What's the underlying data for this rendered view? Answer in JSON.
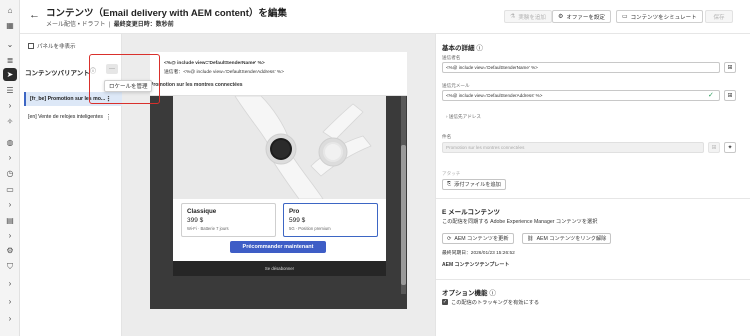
{
  "header": {
    "title": "コンテンツ（Email delivery with AEM content）を編集",
    "subtitle_type": "メール配信",
    "subtitle_status": "ドラフト",
    "subtitle_modified_label": "最終変更日時：",
    "subtitle_modified_value": "数秒前",
    "btn_add_experiment": "実験を追加",
    "btn_offer_settings": "オファーを設定",
    "btn_simulate": "コンテンツをシミュレート",
    "btn_save": "保存"
  },
  "left_panel": {
    "toggle_label": "パネルを非表示",
    "variants_title": "コンテンツバリアント",
    "popover_item": "ロケールを管理",
    "variants": [
      {
        "label": "[fr_be] Promotion sur les mo..."
      },
      {
        "label": "[en] Vente de relojes inteligentes"
      }
    ]
  },
  "preview": {
    "sender_name_line": "<%@ include view='DefaultSenderName' %>",
    "sender_address_line": "送信者：<%@ include view='DefaultSenderAddress' %>",
    "subject": "Promotion sur les montres connectées",
    "plans": [
      {
        "name": "Classique",
        "price": "399 $",
        "desc": "Wi-Fi · Batterie 7 jours"
      },
      {
        "name": "Pro",
        "price": "599 $",
        "desc": "5G · Position premium"
      }
    ],
    "cta_label": "Précommander maintenant",
    "footer": "Se désabonner"
  },
  "right_panel": {
    "basic_title": "基本の詳細",
    "sender_name_label": "送信者名",
    "sender_name_value": "<%@ include view='DefaultSenderName' %>",
    "sender_email_label": "送信元メール",
    "sender_email_value": "<%@ include view='DefaultSenderAddress' %>",
    "preheader_label": "送信先アドレス",
    "subject_label": "件名",
    "subject_value": "Promotion sur les montres connectées",
    "attachment_label": "アタッチ",
    "attachment_btn": "添付ファイルを追加",
    "email_content_title": "E メールコンテンツ",
    "email_content_desc": "この配信を同期する Adobe Experience Manager コンテンツを選択",
    "btn_refresh": "AEM コンテンツを更新",
    "btn_unlink": "AEM コンテンツをリンク解除",
    "last_sync": "最終同期日：2026/01/23 15:26:52",
    "template_label": "AEM コンテンツテンプレート",
    "options_title": "オプション機能",
    "tracking_label": "この配信のトラッキングを有効にする"
  }
}
